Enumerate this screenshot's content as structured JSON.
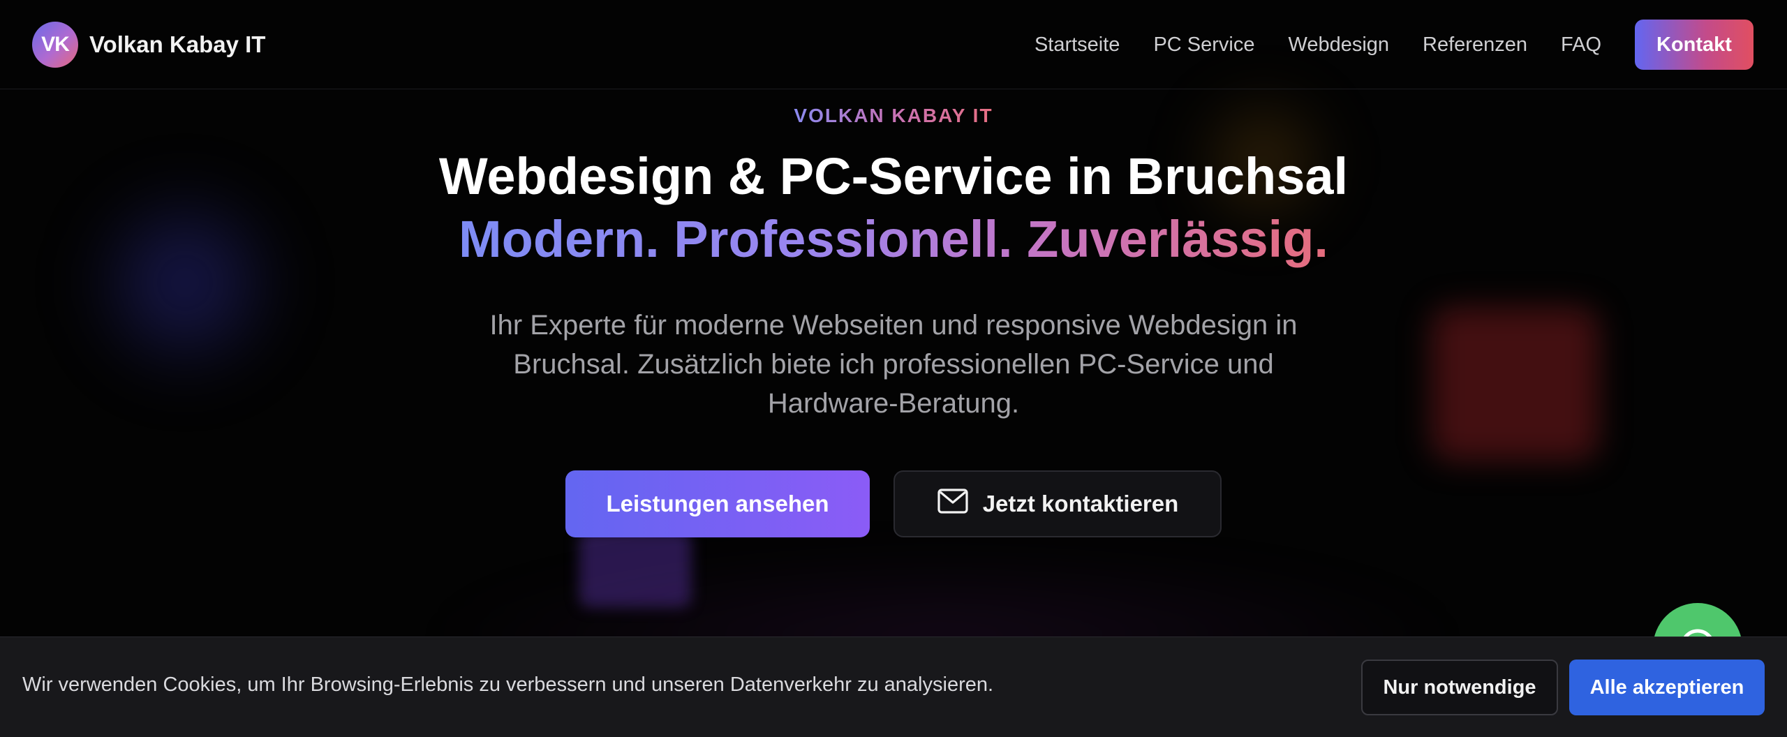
{
  "brand": {
    "logo_initials": "VK",
    "name": "Volkan Kabay IT"
  },
  "nav": {
    "items": [
      "Startseite",
      "PC Service",
      "Webdesign",
      "Referenzen",
      "FAQ"
    ],
    "cta_label": "Kontakt"
  },
  "hero": {
    "eyebrow": "VOLKAN KABAY IT",
    "title": "Webdesign & PC-Service in Bruchsal",
    "tagline": "Modern. Professionell. Zuverlässig.",
    "description": "Ihr Experte für moderne Webseiten und responsive Webdesign in Bruchsal. Zusätzlich biete ich professionellen PC-Service und Hardware-Beratung.",
    "primary_button": "Leistungen ansehen",
    "secondary_button": "Jetzt kontaktieren",
    "secondary_icon": "mail-icon"
  },
  "floating_button": {
    "icon": "whatsapp-icon"
  },
  "cookie_banner": {
    "text": "Wir verwenden Cookies, um Ihr Browsing-Erlebnis zu verbessern und unseren Datenverkehr zu analysieren.",
    "necessary_label": "Nur notwendige",
    "accept_label": "Alle akzeptieren"
  },
  "colors": {
    "accent": "#6366f1",
    "accent_end": "#e14f61",
    "cookie_accept": "#2f63e0",
    "whatsapp": "#4fc76c"
  }
}
